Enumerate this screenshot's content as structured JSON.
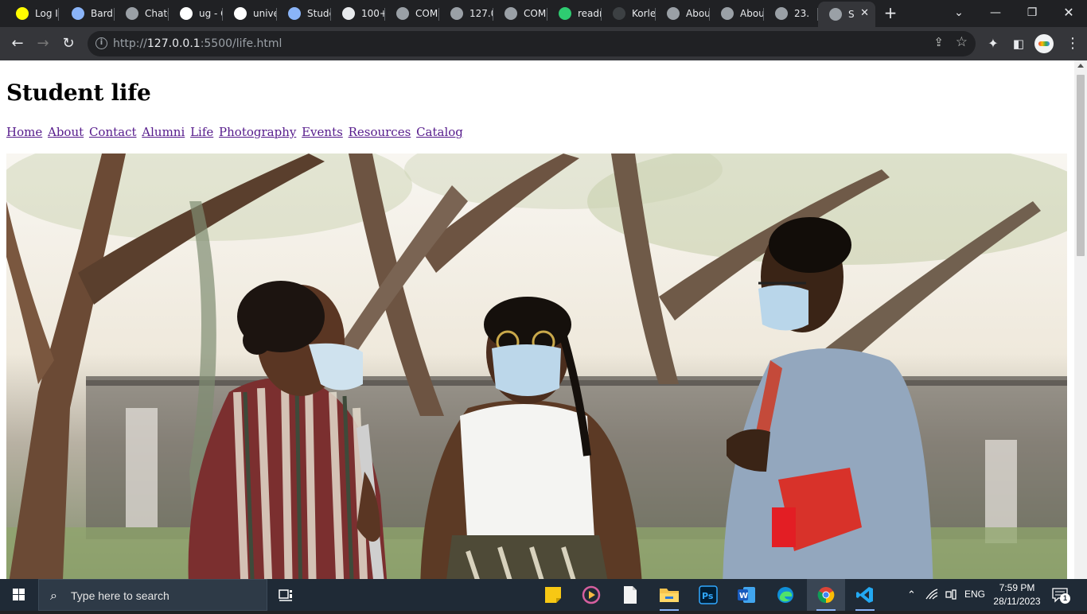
{
  "browser": {
    "tabs": [
      {
        "title": "Log I",
        "favicon": "snapchat-icon",
        "color": "#fffc00"
      },
      {
        "title": "Bard",
        "favicon": "bard-icon",
        "color": "#8ab4f8"
      },
      {
        "title": "ChatG",
        "favicon": "chatgpt-icon",
        "color": "#9aa0a6"
      },
      {
        "title": "ug - G",
        "favicon": "google-icon",
        "color": "#ffffff"
      },
      {
        "title": "unive",
        "favicon": "google-icon",
        "color": "#ffffff"
      },
      {
        "title": "Stude",
        "favicon": "university-icon",
        "color": "#8ab4f8"
      },
      {
        "title": "100+",
        "favicon": "site-icon",
        "color": "#e8eaed"
      },
      {
        "title": "COM",
        "favicon": "globe-icon",
        "color": "#9aa0a6"
      },
      {
        "title": "127.0",
        "favicon": "globe-icon",
        "color": "#9aa0a6"
      },
      {
        "title": "COM",
        "favicon": "globe-icon",
        "color": "#9aa0a6"
      },
      {
        "title": "readr",
        "favicon": "readme-icon",
        "color": "#2ecc71"
      },
      {
        "title": "Korle",
        "favicon": "loading-icon",
        "color": "#3c4043"
      },
      {
        "title": "Abou",
        "favicon": "globe-icon",
        "color": "#9aa0a6"
      },
      {
        "title": "Abou",
        "favicon": "globe-icon",
        "color": "#9aa0a6"
      },
      {
        "title": "23.",
        "favicon": "globe-icon",
        "color": "#9aa0a6"
      },
      {
        "title": "S",
        "favicon": "globe-icon",
        "color": "#9aa0a6",
        "active": true
      }
    ],
    "url_host": "127.0.0.1",
    "url_prefix": "http://",
    "url_rest": ":5500/life.html"
  },
  "page": {
    "heading": "Student life",
    "nav": [
      "Home",
      "About",
      "Contact",
      "Alumni",
      "Life",
      "Photography",
      "Events",
      "Resources",
      "Catalog"
    ]
  },
  "taskbar": {
    "search_placeholder": "Type here to search",
    "language": "ENG",
    "time": "7:59 PM",
    "date": "28/11/2023",
    "notification_count": "1"
  }
}
